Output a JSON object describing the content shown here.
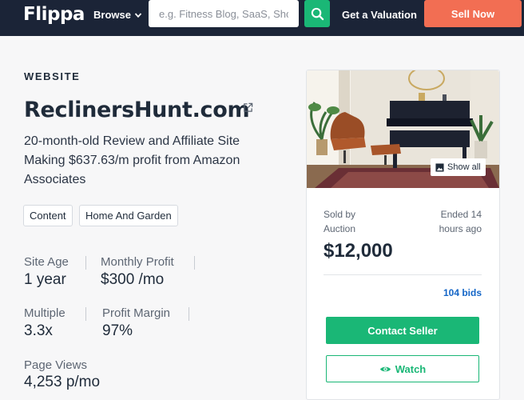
{
  "nav": {
    "logo": "Flippa",
    "browse_label": "Browse",
    "search_placeholder": "e.g. Fitness Blog, SaaS, Shop",
    "valuation_label": "Get a Valuation",
    "sell_label": "Sell Now"
  },
  "listing": {
    "category": "WEBSITE",
    "title": "ReclinersHunt.com",
    "description": "20-month-old Review and Affiliate Site Making $637.63/m profit from Amazon Associates",
    "tags": [
      "Content",
      "Home And Garden"
    ],
    "metrics": {
      "site_age": {
        "label": "Site Age",
        "value": "1 year"
      },
      "monthly_profit": {
        "label": "Monthly Profit",
        "value": "$300 /mo"
      },
      "multiple": {
        "label": "Multiple",
        "value": "3.3x"
      },
      "profit_margin": {
        "label": "Profit Margin",
        "value": "97%"
      },
      "page_views": {
        "label": "Page Views",
        "value": "4,253 p/mo"
      }
    }
  },
  "card": {
    "show_all_label": "Show all",
    "sold_by": "Sold by Auction",
    "ended": "Ended 14 hours ago",
    "price": "$12,000",
    "bids": "104 bids",
    "contact_label": "Contact Seller",
    "watch_label": "Watch"
  },
  "colors": {
    "nav_bg": "#1b2437",
    "accent_green": "#1ab776",
    "sell_orange": "#f26e53",
    "link_blue": "#1466c7"
  }
}
